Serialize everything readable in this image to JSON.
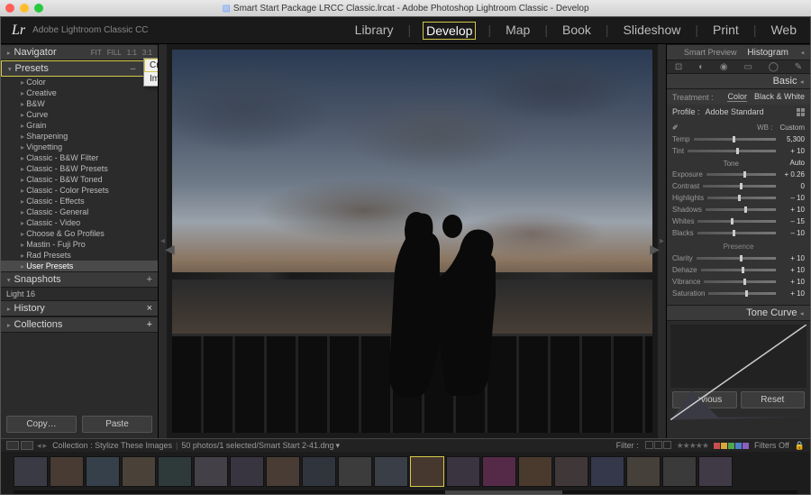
{
  "titlebar": {
    "title": "Smart Start Package LRCC Classic.lrcat - Adobe Photoshop Lightroom Classic - Develop"
  },
  "header": {
    "logo": "Lr",
    "appname": "Adobe Lightroom Classic CC",
    "modules": [
      "Library",
      "Develop",
      "Map",
      "Book",
      "Slideshow",
      "Print",
      "Web"
    ],
    "selected_module": "Develop"
  },
  "left": {
    "navigator": {
      "title": "Navigator",
      "modes": [
        "FIT",
        "FILL",
        "1:1",
        "3:1"
      ]
    },
    "presets": {
      "title": "Presets",
      "items": [
        "Color",
        "Creative",
        "B&W",
        "Curve",
        "Grain",
        "Sharpening",
        "Vignetting",
        "Classic - B&W Filter",
        "Classic - B&W Presets",
        "Classic - B&W Toned",
        "Classic - Color Presets",
        "Classic - Effects",
        "Classic - General",
        "Classic - Video",
        "Choose & Go Profiles",
        "Mastin - Fuji Pro",
        "Rad Presets",
        "User Presets"
      ],
      "selected": "User Presets",
      "pm": "–  +"
    },
    "context_menu": {
      "items": [
        "Create Preset…",
        "Import Preset(s)…"
      ],
      "highlight": "Create Preset…"
    },
    "snapshots": {
      "title": "Snapshots",
      "item": "Light 16",
      "plus": "+"
    },
    "history": {
      "title": "History",
      "icon": "×"
    },
    "collections": {
      "title": "Collections",
      "icon": "+"
    },
    "copy": "Copy…",
    "paste": "Paste"
  },
  "right": {
    "smart_preview": "Smart Preview",
    "histogram": "Histogram",
    "basic": {
      "title": "Basic",
      "treatment_label": "Treatment :",
      "treatment_color": "Color",
      "treatment_bw": "Black & White",
      "profile_label": "Profile :",
      "profile_value": "Adobe Standard",
      "wb_label": "WB :",
      "wb_value": "Custom",
      "temp": {
        "label": "Temp",
        "value": "5,300",
        "pos": 48
      },
      "tint": {
        "label": "Tint",
        "value": "+ 10",
        "pos": 55
      },
      "tone_label": "Tone",
      "auto": "Auto",
      "exposure": {
        "label": "Exposure",
        "value": "+ 0.26",
        "pos": 53
      },
      "contrast": {
        "label": "Contrast",
        "value": "0",
        "pos": 50
      },
      "highlights": {
        "label": "Highlights",
        "value": "– 10",
        "pos": 45
      },
      "shadows": {
        "label": "Shadows",
        "value": "+ 10",
        "pos": 55
      },
      "whites": {
        "label": "Whites",
        "value": "– 15",
        "pos": 42
      },
      "blacks": {
        "label": "Blacks",
        "value": "– 10",
        "pos": 45
      },
      "presence_label": "Presence",
      "clarity": {
        "label": "Clarity",
        "value": "+ 10",
        "pos": 55
      },
      "dehaze": {
        "label": "Dehaze",
        "value": "+ 10",
        "pos": 55
      },
      "vibrance": {
        "label": "Vibrance",
        "value": "+ 10",
        "pos": 55
      },
      "saturation": {
        "label": "Saturation",
        "value": "+ 10",
        "pos": 55
      }
    },
    "tone_curve": "Tone Curve",
    "previous": "Previous",
    "reset": "Reset"
  },
  "filmstrip": {
    "collection_label": "Collection :",
    "collection_name": "Stylize These Images",
    "count": "50 photos",
    "selected": "1 selected",
    "filename": "Smart Start 2-41.dng",
    "filter_label": "Filter :",
    "filters_off": "Filters Off",
    "thumb_count": 20,
    "selected_index": 11,
    "thumb_colors": [
      "#3a3a44",
      "#473b34",
      "#36404a",
      "#4a4238",
      "#2e3a3a",
      "#444048",
      "#383440",
      "#483c34",
      "#30343c",
      "#3c3c3c",
      "#3a3e46",
      "#46382e",
      "#3a3440",
      "#542a48",
      "#4a3a2e",
      "#403838",
      "#34384a",
      "#46403a",
      "#3a3a3a",
      "#403a46"
    ],
    "label_colors": [
      "#c94f4f",
      "#d8a93a",
      "#4fa64f",
      "#4f7fc9",
      "#8a5fc0"
    ]
  }
}
